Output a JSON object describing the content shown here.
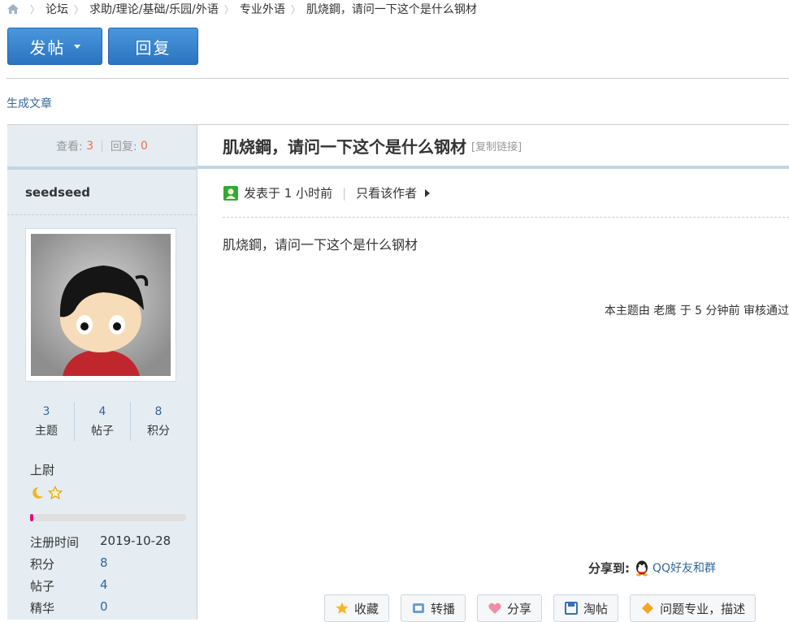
{
  "breadcrumb": {
    "items": [
      "论坛",
      "求助/理论/基础/乐园/外语",
      "专业外语",
      "肌烧鋼，请问一下这个是什么钢材"
    ]
  },
  "buttons": {
    "post": "发帖",
    "reply": "回复"
  },
  "generate_article": "生成文章",
  "sidebar": {
    "views_label": "查看:",
    "views": "3",
    "replies_label": "回复:",
    "replies": "0",
    "username": "seedseed",
    "stats": [
      {
        "value": "3",
        "label": "主题"
      },
      {
        "value": "4",
        "label": "帖子"
      },
      {
        "value": "8",
        "label": "积分"
      }
    ],
    "rank": "上尉",
    "rank_icons": [
      "moon-icon",
      "star-icon"
    ],
    "progress": 0.02,
    "info": [
      {
        "key": "注册时间",
        "value": "2019-10-28"
      },
      {
        "key": "积分",
        "value": "8"
      },
      {
        "key": "帖子",
        "value": "4"
      },
      {
        "key": "精华",
        "value": "0"
      }
    ]
  },
  "post": {
    "title": "肌烧鋼，请问一下这个是什么钢材",
    "copy_link": "[复制链接]",
    "posted": "发表于 1 小时前",
    "only_author": "只看该作者",
    "body": "肌烧鋼，请问一下这个是什么钢材",
    "moderation": "本主题由 老鹰 于 5 分钟前 审核通过",
    "share_label": "分享到:",
    "share_qq": "QQ好友和群"
  },
  "actions": [
    {
      "icon": "star-icon",
      "label": "收藏"
    },
    {
      "icon": "thumb-icon",
      "label": "转播"
    },
    {
      "icon": "heart-icon",
      "label": "分享"
    },
    {
      "icon": "save-icon",
      "label": "淘帖"
    },
    {
      "icon": "diamond-icon",
      "label": "问题专业，描述"
    }
  ],
  "colors": {
    "accent": "#336699",
    "button": "#2b73c0",
    "highlight": "#f26c4f",
    "sidebar_bg": "#e5edf2"
  }
}
